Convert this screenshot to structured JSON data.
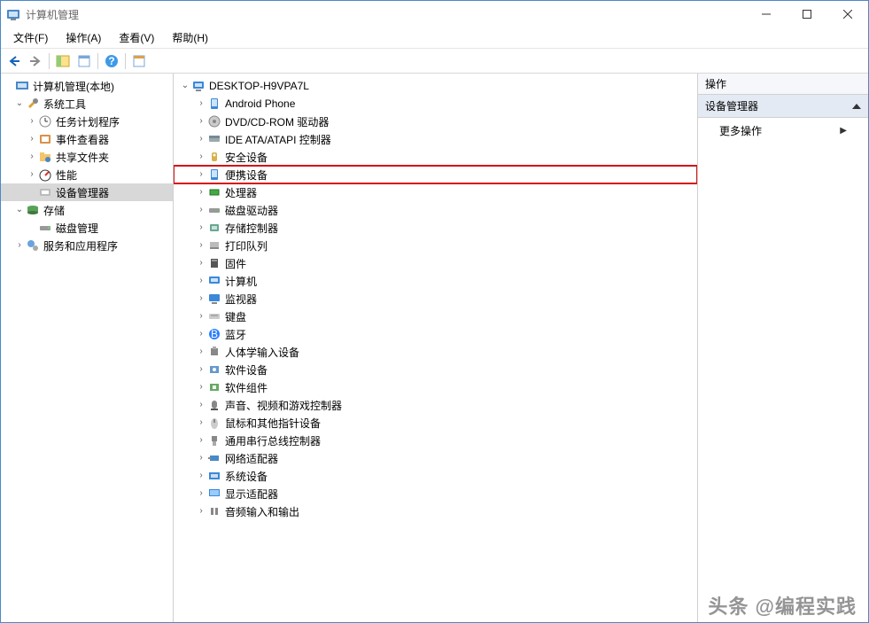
{
  "titlebar": {
    "title": "计算机管理"
  },
  "menubar": {
    "file": "文件(F)",
    "action": "操作(A)",
    "view": "查看(V)",
    "help": "帮助(H)"
  },
  "left_tree": {
    "root": "计算机管理(本地)",
    "sys_tools": "系统工具",
    "task_sched": "任务计划程序",
    "event_viewer": "事件查看器",
    "shared_folders": "共享文件夹",
    "performance": "性能",
    "device_mgr": "设备管理器",
    "storage": "存储",
    "disk_mgmt": "磁盘管理",
    "services": "服务和应用程序"
  },
  "devices": {
    "root": "DESKTOP-H9VPA7L",
    "items": [
      "Android Phone",
      "DVD/CD-ROM 驱动器",
      "IDE ATA/ATAPI 控制器",
      "安全设备",
      "便携设备",
      "处理器",
      "磁盘驱动器",
      "存储控制器",
      "打印队列",
      "固件",
      "计算机",
      "监视器",
      "键盘",
      "蓝牙",
      "人体学输入设备",
      "软件设备",
      "软件组件",
      "声音、视频和游戏控制器",
      "鼠标和其他指针设备",
      "通用串行总线控制器",
      "网络适配器",
      "系统设备",
      "显示适配器",
      "音频输入和输出"
    ]
  },
  "actions": {
    "header": "操作",
    "subheader": "设备管理器",
    "more": "更多操作"
  },
  "watermark": "头条 @编程实践"
}
